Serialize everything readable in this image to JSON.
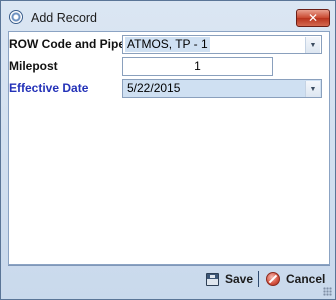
{
  "window": {
    "title": "Add Record",
    "close_glyph": "✕"
  },
  "form": {
    "row_code_label": "ROW Code and Pipe",
    "row_code_value": "ATMOS, TP - 1",
    "milepost_label": "Milepost",
    "milepost_value": "1",
    "effective_date_label": "Effective Date",
    "effective_date_value": "5/22/2015"
  },
  "footer": {
    "save_label": "Save",
    "cancel_label": "Cancel"
  },
  "icons": {
    "app": "target-icon",
    "close": "close-icon",
    "save": "floppy-disk-icon",
    "cancel": "cancel-icon",
    "dropdown": "chevron-down-icon"
  },
  "colors": {
    "effective_date_label": "#2432b8",
    "close_button": "#c9472f",
    "selection": "#cfe0f2"
  }
}
